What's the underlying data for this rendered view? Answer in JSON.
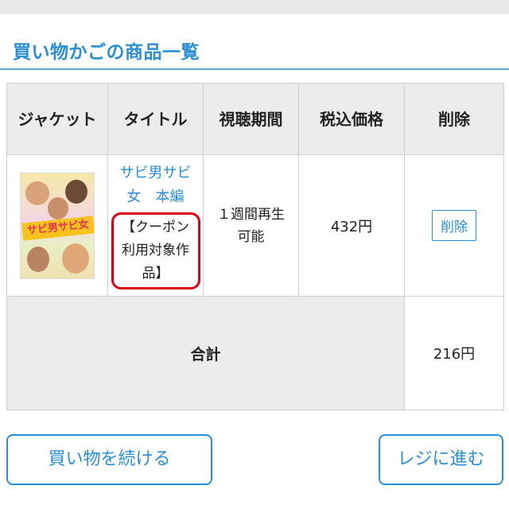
{
  "page": {
    "title": "買い物かごの商品一覧"
  },
  "table": {
    "headers": {
      "jacket": "ジャケット",
      "title": "タイトル",
      "period": "視聴期間",
      "price": "税込価格",
      "delete": "削除"
    },
    "items": [
      {
        "title": "サビ男サビ女　本編",
        "coupon": "【クーポン利用対象作品】",
        "period": "１週間再生可能",
        "price": "432円",
        "delete_label": "削除",
        "jacket_logo": "サビ男サビ女"
      }
    ],
    "total_label": "合計",
    "total_value": "216円"
  },
  "buttons": {
    "continue": "買い物を続ける",
    "checkout": "レジに進む"
  },
  "colors": {
    "accent": "#2a8fd6",
    "coupon_border": "#e00012",
    "header_bg": "#ececec"
  }
}
